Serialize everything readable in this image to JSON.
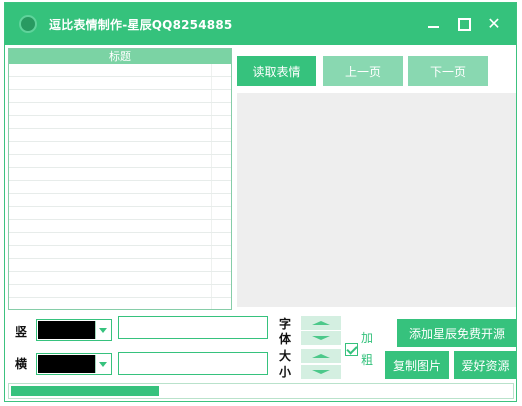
{
  "window": {
    "title": "逗比表情制作-星辰QQ8254885",
    "accent": "#35c27c"
  },
  "list": {
    "header": "标题",
    "rows": [
      "",
      "",
      "",
      "",
      "",
      "",
      "",
      "",
      "",
      "",
      "",
      "",
      "",
      "",
      "",
      "",
      "",
      "",
      ""
    ]
  },
  "buttons": {
    "read": "读取表情",
    "prev": "上一页",
    "next": "下一页",
    "add": "添加星辰免费开源",
    "copy": "复制图片",
    "love": "爱好资源"
  },
  "labels": {
    "vertical": "竖",
    "horizontal": "横",
    "font_size_chars": [
      "字",
      "体",
      "大",
      "小"
    ],
    "bold_chars": [
      "加",
      "粗"
    ]
  },
  "inputs": {
    "vertical_text": "",
    "horizontal_text": ""
  },
  "colors": {
    "vertical_color": "#000000",
    "horizontal_color": "#000000"
  },
  "bold_checked": true,
  "progress": {
    "fraction": 0.295
  }
}
